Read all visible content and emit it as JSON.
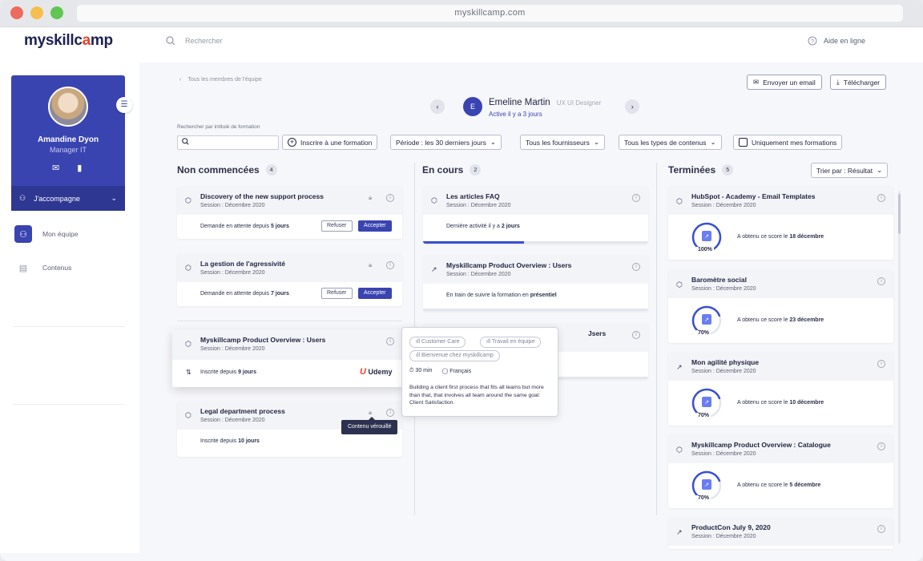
{
  "browser": {
    "url": "myskillcamp.com"
  },
  "header": {
    "logo": "myskillc",
    "logo_accent": "a",
    "logo_end": "mp",
    "search_placeholder": "Rechercher",
    "help": "Aide en ligne"
  },
  "profile": {
    "name": "Amandine Dyon",
    "role": "Manager IT",
    "accompany": "J'accompagne"
  },
  "nav": [
    {
      "label": "Mon équipe"
    },
    {
      "label": "Contenus"
    }
  ],
  "breadcrumb": "Tous les membres de l'équipe",
  "actions": {
    "email": "Envoyer un email",
    "download": "Télécharger"
  },
  "member": {
    "initial": "E",
    "name": "Emeline Martin",
    "role": "UX UI Designer",
    "status": "Active il y a 3 jours"
  },
  "filters": {
    "search_label": "Rechercher par intitulé de formation",
    "enroll": "Inscrire à une formation",
    "period": "Période :  les 30 derniers jours",
    "providers": "Tous les fournisseurs",
    "types": "Tous les types de contenus",
    "mine": "Uniquement mes formations"
  },
  "columns": {
    "not_started": {
      "title": "Non commencées",
      "count": "4",
      "cards": [
        {
          "title": "Discovery of the new support process",
          "session": "Session : Décembre 2020",
          "status": "Demande en attente depuis",
          "days": "5 jours",
          "refuse": "Refuser",
          "accept": "Accepter"
        },
        {
          "title": "La gestion de l'agressivité",
          "session": "Session : Décembre 2020",
          "status": "Demande en attente depuis",
          "days": "7 jours",
          "refuse": "Refuser",
          "accept": "Accepter"
        },
        {
          "title": "Myskillcamp Product Overview : Users",
          "session": "Session : Décembre 2020",
          "status": "Inscrite depuis",
          "days": "9 jours",
          "provider": "Udemy"
        },
        {
          "title": "Legal department process",
          "session": "Session : Décembre 2020",
          "status": "Inscrite depuis",
          "days": "10 jours"
        }
      ]
    },
    "in_progress": {
      "title": "En cours",
      "count": "2",
      "cards": [
        {
          "title": "Les articles FAQ",
          "session": "Session : Décembre 2020",
          "status": "Dernière activité il y a",
          "strong": "2 jours",
          "progress": 0.45
        },
        {
          "title": "Myskillcamp Product Overview : Users",
          "session": "Session : Décembre 2020",
          "status": "En train de suivre la formation en",
          "strong": "présentiel"
        },
        {
          "title_tail": "Jsers"
        }
      ]
    },
    "done": {
      "title": "Terminées",
      "count": "5",
      "sort": "Trier par : Résultat",
      "cards": [
        {
          "title": "HubSpot - Academy - Email Templates",
          "session": "Session : Décembre 2020",
          "score": "100%",
          "score_value": 1.0,
          "text": "A obtenu ce score le",
          "date": "18 décembre"
        },
        {
          "title": "Baromètre social",
          "session": "Session : Décembre 2020",
          "score": "70%",
          "score_value": 0.7,
          "text": "A obtenu ce score le",
          "date": "23 décembre"
        },
        {
          "title": "Mon agilité physique",
          "session": "Session : Décembre 2020",
          "score": "70%",
          "score_value": 0.7,
          "text": "A obtenu ce score le",
          "date": "10 décembre"
        },
        {
          "title": "Myskillcamp Product Overview : Catalogue",
          "session": "Session : Décembre 2020",
          "score": "70%",
          "score_value": 0.7,
          "text": "A obtenu ce score le",
          "date": "5 décembre"
        },
        {
          "title": "ProductCon July 9, 2020",
          "session": "Session : Décembre 2020"
        }
      ]
    }
  },
  "tooltip": {
    "tags": [
      "Customer Care",
      "Travail en équipe",
      "Bienvenue chez myskillcamp"
    ],
    "duration": "30 min",
    "language": "Français",
    "description": "Building a client first process that fits all teams but more than that, that involves all team around the same goal: Client Satisfaction."
  },
  "locked_tooltip": "Contenu vérouillé",
  "colors": {
    "primary": "#3a44b0",
    "logo_dark": "#1e2154",
    "logo_accent": "#e8432b",
    "udemy": "#a435f0"
  }
}
